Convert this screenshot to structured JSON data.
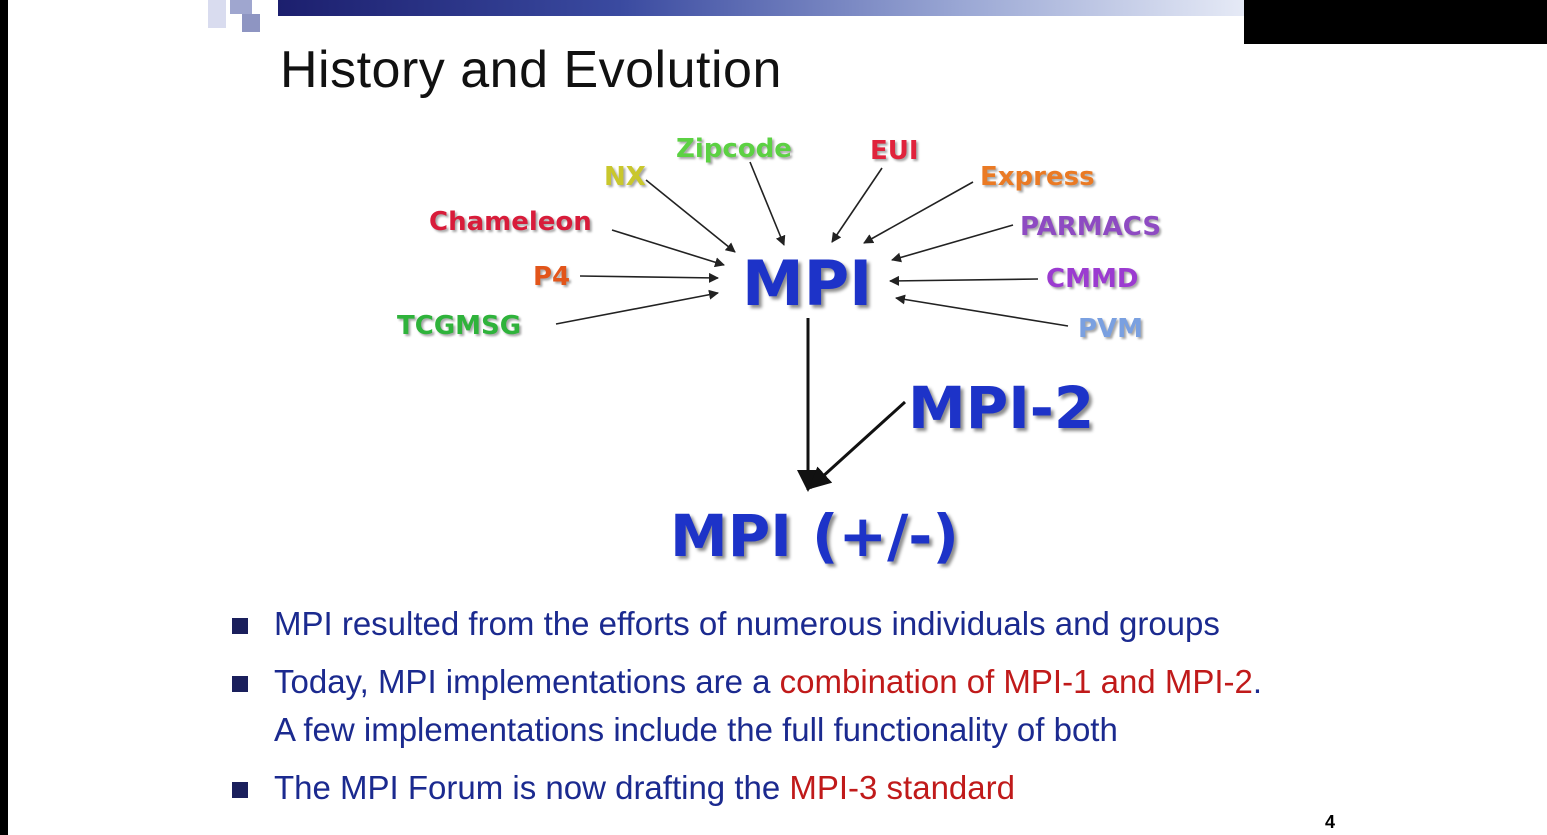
{
  "slide": {
    "title": "History and Evolution",
    "page_number": "4"
  },
  "diagram": {
    "center": "MPI",
    "mpi2": "MPI-2",
    "result": "MPI (+/-)",
    "sources": {
      "zipcode": {
        "label": "Zipcode",
        "color": "#5cd143"
      },
      "eui": {
        "label": "EUI",
        "color": "#e0233c"
      },
      "nx": {
        "label": "NX",
        "color": "#c9c72c"
      },
      "express": {
        "label": "Express",
        "color": "#ea7a24"
      },
      "chameleon": {
        "label": "Chameleon",
        "color": "#d81c3a"
      },
      "parmacs": {
        "label": "PARMACS",
        "color": "#8e4bc2"
      },
      "p4": {
        "label": "P4",
        "color": "#e2551a"
      },
      "cmmd": {
        "label": "CMMD",
        "color": "#9b3bd0"
      },
      "tcgmsg": {
        "label": "TCGMSG",
        "color": "#2fb33b"
      },
      "pvm": {
        "label": "PVM",
        "color": "#7aa0e0"
      }
    }
  },
  "bullets": [
    {
      "parts": [
        "MPI resulted from the efforts of numerous individuals and groups"
      ]
    },
    {
      "pre": "Today, MPI implementations are a ",
      "highlight": "combination of MPI-1 and MPI-2",
      "post": ".",
      "line2": "A few implementations include the full functionality of both"
    },
    {
      "pre": "The MPI Forum is now drafting the ",
      "highlight": "MPI-3 standard"
    }
  ],
  "colors": {
    "bullet_text": "#1b2a8f",
    "highlight": "#c01a1a",
    "mpi_blue": "#1d33c8"
  }
}
